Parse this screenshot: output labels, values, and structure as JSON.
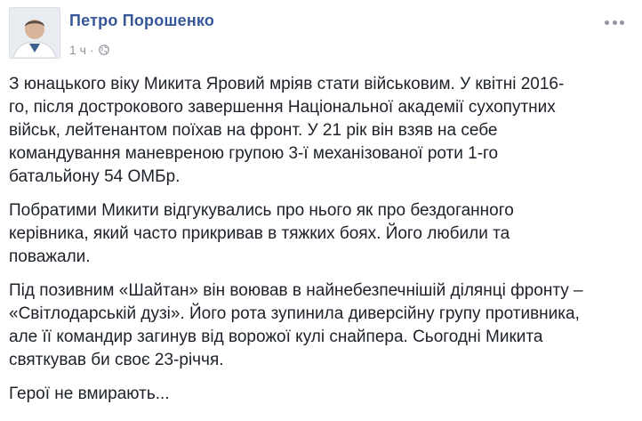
{
  "author": {
    "name": "Петро Порошенко"
  },
  "post_meta": {
    "time": "1 ч",
    "separator": "·",
    "privacy_icon": "globe-icon"
  },
  "menu_icon": "more-options-icon",
  "paragraphs": [
    "З юнацького віку Микита Яровий мріяв стати військовим. У квітні 2016-\nго, після дострокового завершення Національної академії сухопутних\nвійськ, лейтенантом поїхав на фронт. У 21 рік він взяв на себе\nкомандування маневреною групою 3-ї механізованої роти 1-го\nбатальйону 54 ОМБр.",
    "Побратими Микити відгукувались про нього як про бездоганного\nкерівника, який часто прикривав в тяжких боях. Його любили та\nповажали.",
    "Під позивним «Шайтан» він воював в найнебезпечнішій ділянці фронту –\n«Світлодарській дузі». Його рота зупинила диверсійну групу противника,\nале її командир загинув від ворожої кулі снайпера. Сьогодні Микита\nсвяткував би своє 23-річчя.",
    "Герої не вмирають..."
  ],
  "colors": {
    "link": "#365899",
    "meta": "#90949c",
    "text": "#1d2129"
  }
}
